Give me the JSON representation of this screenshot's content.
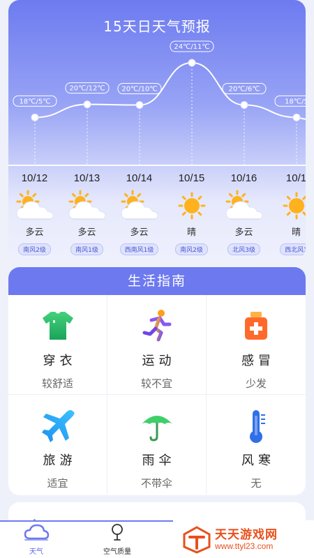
{
  "forecast": {
    "title": "15天日天气预报",
    "days": [
      {
        "date": "10/12",
        "temp": "18℃/5℃",
        "condition": "多云",
        "wind": "南风2级",
        "icon": "partly-cloudy-icon",
        "level": 0.12
      },
      {
        "date": "10/13",
        "temp": "20℃/12℃",
        "condition": "多云",
        "wind": "南风1级",
        "icon": "partly-cloudy-icon",
        "level": 0.33
      },
      {
        "date": "10/14",
        "temp": "20℃/10℃",
        "condition": "多云",
        "wind": "西南风1级",
        "icon": "partly-cloudy-icon",
        "level": 0.32
      },
      {
        "date": "10/15",
        "temp": "24℃/11℃",
        "condition": "晴",
        "wind": "南风2级",
        "icon": "sun-icon",
        "level": 1.0
      },
      {
        "date": "10/16",
        "temp": "20℃/6℃",
        "condition": "多云",
        "wind": "北风3级",
        "icon": "partly-cloudy-icon",
        "level": 0.32
      },
      {
        "date": "10/1",
        "temp": "18℃/5",
        "condition": "晴",
        "wind": "西北风1",
        "icon": "sun-icon",
        "level": 0.12
      }
    ]
  },
  "guide": {
    "title": "生活指南",
    "items": [
      {
        "name": "穿衣",
        "value": "较舒适",
        "icon": "tshirt-icon"
      },
      {
        "name": "运动",
        "value": "较不宜",
        "icon": "running-icon"
      },
      {
        "name": "感冒",
        "value": "少发",
        "icon": "medicine-icon"
      },
      {
        "name": "旅游",
        "value": "适宜",
        "icon": "airplane-icon"
      },
      {
        "name": "雨伞",
        "value": "不带伞",
        "icon": "umbrella-icon"
      },
      {
        "name": "风寒",
        "value": "无",
        "icon": "thermometer-icon"
      }
    ]
  },
  "tabs": [
    {
      "label": "天气",
      "icon": "weather-cloud-icon",
      "active": true
    },
    {
      "label": "空气质量",
      "icon": "air-quality-icon",
      "active": false
    }
  ],
  "watermark": {
    "title": "天天游戏网",
    "url": "www.ttyl23.com"
  },
  "colors": {
    "accent": "#6d79ef",
    "sun": "#ffb21e",
    "wind_badge": "#4a57d8",
    "watermark": "#e8501d"
  }
}
